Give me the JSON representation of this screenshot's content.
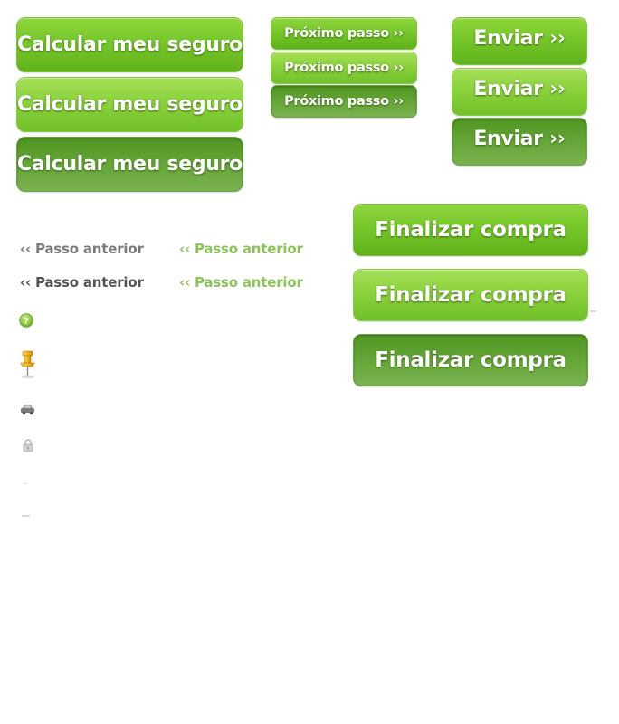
{
  "calcular": {
    "normal": "Calcular meu seguro",
    "hover": "Calcular meu seguro",
    "active": "Calcular meu seguro"
  },
  "proximo": {
    "normal": "Próximo passo ››",
    "hover": "Próximo passo ››",
    "active": "Próximo passo ››"
  },
  "enviar": {
    "normal": "Enviar ››",
    "hover": "Enviar ››",
    "active": "Enviar ››"
  },
  "finalizar": {
    "normal": "Finalizar compra",
    "hover": "Finalizar compra",
    "active": "Finalizar compra"
  },
  "passo_anterior": {
    "gray": "‹‹ Passo anterior",
    "dark": "‹‹ Passo anterior",
    "green": "‹‹ Passo anterior",
    "green_2": "‹‹ Passo anterior"
  },
  "icons": {
    "help": "help-icon",
    "pushpin": "pushpin-icon",
    "car": "car-icon",
    "lock": "lock-icon"
  },
  "colors": {
    "green_button": "#76c72a",
    "green_button_hover": "#8ad23c",
    "green_button_active": "#5e9e33",
    "link_gray": "#7a7a7a",
    "link_green": "#8dc25a"
  }
}
